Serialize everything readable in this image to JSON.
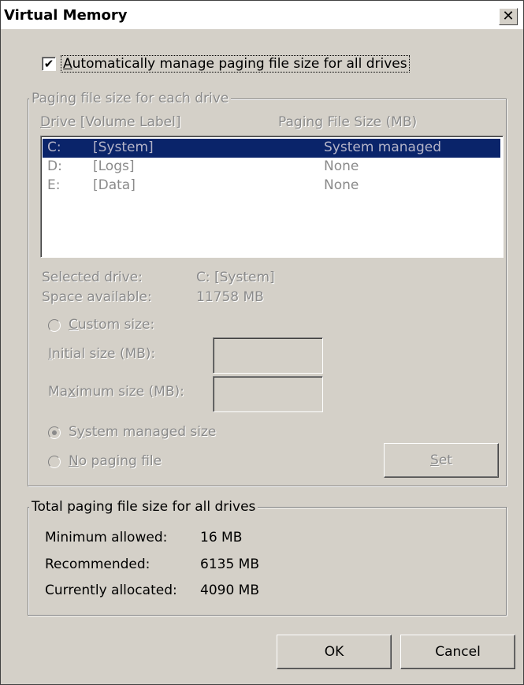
{
  "window": {
    "title": "Virtual Memory",
    "close_glyph": "✕"
  },
  "auto_manage": {
    "checked": true,
    "check_glyph": "✔",
    "label_underlined": "A",
    "label_rest": "utomatically manage paging file size for all drives"
  },
  "paging_group": {
    "legend": "Paging file size for each drive",
    "col_drive_u": "D",
    "col_drive_rest": "rive  [Volume Label]",
    "col_size": "Paging File Size (MB)",
    "drives": [
      {
        "letter": "C:",
        "label": "[System]",
        "size": "System managed",
        "selected": true
      },
      {
        "letter": "D:",
        "label": "[Logs]",
        "size": "None",
        "selected": false
      },
      {
        "letter": "E:",
        "label": "[Data]",
        "size": "None",
        "selected": false
      }
    ],
    "selected_drive_label": "Selected drive:",
    "selected_drive_value": "C:  [System]",
    "space_available_label": "Space available:",
    "space_available_value": "11758 MB",
    "custom_size": {
      "u": "C",
      "rest": "ustom size:"
    },
    "initial_size": {
      "u": "I",
      "rest": "nitial size (MB):"
    },
    "maximum_size": {
      "pre": "Ma",
      "u": "x",
      "rest": "imum size (MB):"
    },
    "system_managed": {
      "pre": "S",
      "u": "y",
      "rest": "stem managed size",
      "selected": true
    },
    "no_paging": {
      "u": "N",
      "rest": "o paging file"
    },
    "set_button": {
      "u": "S",
      "rest": "et"
    }
  },
  "total_group": {
    "legend": "Total paging file size for all drives",
    "rows": [
      {
        "label": "Minimum allowed:",
        "value": "16 MB"
      },
      {
        "label": "Recommended:",
        "value": "6135 MB"
      },
      {
        "label": "Currently allocated:",
        "value": "4090 MB"
      }
    ]
  },
  "buttons": {
    "ok": "OK",
    "cancel": "Cancel"
  }
}
